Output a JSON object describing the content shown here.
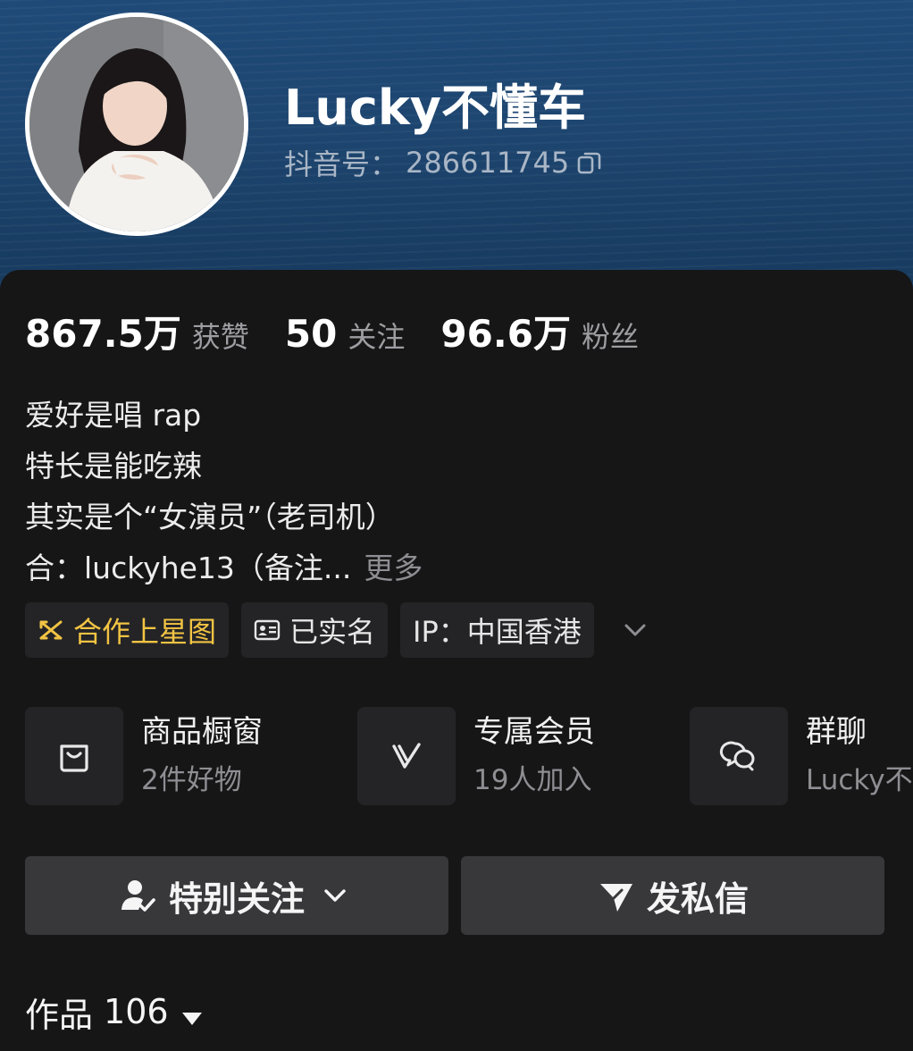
{
  "profile": {
    "nickname": "Lucky不懂车",
    "uid_label": "抖音号：",
    "uid": "286611745"
  },
  "stats": [
    {
      "value": "867.5万",
      "label": "获赞"
    },
    {
      "value": "50",
      "label": "关注"
    },
    {
      "value": "96.6万",
      "label": "粉丝"
    }
  ],
  "bio": {
    "lines": [
      "爱好是唱 rap",
      "特长是能吃辣",
      "其实是个“女演员”（老司机）"
    ],
    "last_line": "合：luckyhe13（备注...",
    "more_label": "更多"
  },
  "tags": {
    "star_map": "合作上星图",
    "verified": "已实名",
    "ip": "IP：中国香港"
  },
  "features": [
    {
      "title": "商品橱窗",
      "subtitle": "2件好物",
      "icon": "shopping-bag-icon"
    },
    {
      "title": "专属会员",
      "subtitle": "19人加入",
      "icon": "vip-v-icon"
    },
    {
      "title": "群聊",
      "subtitle": "Lucky不",
      "icon": "group-chat-icon"
    }
  ],
  "actions": {
    "follow_label": "特别关注",
    "message_label": "发私信"
  },
  "works": {
    "label": "作品",
    "count": "106"
  },
  "colors": {
    "accent_gold": "#f2c443",
    "banner_blue": "#1d456f",
    "background": "#161617"
  }
}
